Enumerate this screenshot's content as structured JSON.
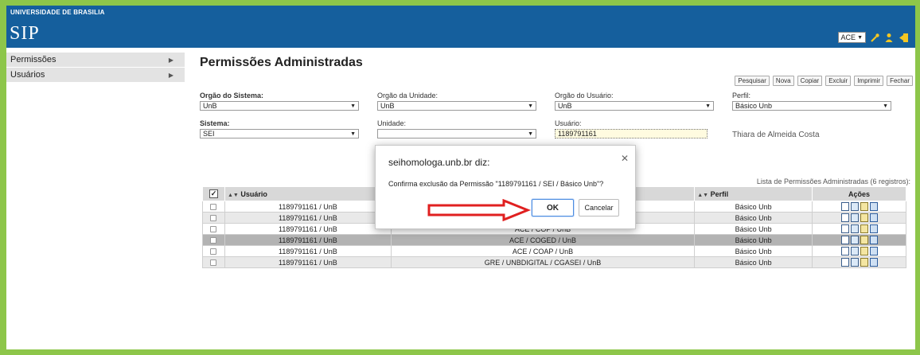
{
  "header": {
    "university": "UNIVERSIDADE DE BRASILIA",
    "app_logo": "SIP",
    "unit_selector": "ACE",
    "icons": [
      "wrench-icon",
      "user-icon",
      "exit-icon"
    ]
  },
  "sidebar": {
    "items": [
      {
        "label": "Permissões"
      },
      {
        "label": "Usuários"
      }
    ]
  },
  "page": {
    "title": "Permissões Administradas"
  },
  "toolbar": {
    "pesquisar": "Pesquisar",
    "nova": "Nova",
    "copiar": "Copiar",
    "excluir": "Excluir",
    "imprimir": "Imprimir",
    "fechar": "Fechar"
  },
  "filters": {
    "orgao_sistema": {
      "label": "Orgão do Sistema:",
      "value": "UnB"
    },
    "orgao_unidade": {
      "label": "Orgão da Unidade:",
      "value": "UnB"
    },
    "orgao_usuario": {
      "label": "Orgão do Usuário:",
      "value": "UnB"
    },
    "perfil": {
      "label": "Perfil:",
      "value": "Básico Unb"
    },
    "sistema": {
      "label": "Sistema:",
      "value": "SEI"
    },
    "unidade": {
      "label": "Unidade:",
      "value": ""
    },
    "usuario": {
      "label": "Usuário:",
      "value": "1189791161"
    },
    "user_name": "Thiara de Almeida Costa"
  },
  "table": {
    "caption": "Lista de Permissões Administradas (6 registros):",
    "headers": {
      "usuario": "Usuário",
      "unidade": "",
      "perfil": "Perfil",
      "acoes": "Ações"
    },
    "rows": [
      {
        "usuario": "1189791161 / UnB",
        "unidade": "",
        "perfil": "Básico Unb"
      },
      {
        "usuario": "1189791161 / UnB",
        "unidade": "",
        "perfil": "Básico Unb"
      },
      {
        "usuario": "1189791161 / UnB",
        "unidade": "ACE / COP / UnB",
        "perfil": "Básico Unb"
      },
      {
        "usuario": "1189791161 / UnB",
        "unidade": "ACE / COGED / UnB",
        "perfil": "Básico Unb"
      },
      {
        "usuario": "1189791161 / UnB",
        "unidade": "ACE / COAP / UnB",
        "perfil": "Básico Unb"
      },
      {
        "usuario": "1189791161 / UnB",
        "unidade": "GRE / UNBDIGITAL / CGASEI / UnB",
        "perfil": "Básico Unb"
      }
    ]
  },
  "dialog": {
    "title": "seihomologa.unb.br diz:",
    "message": "Confirma exclusão da Permissão \"1189791161 / SEI / Básico Unb\"?",
    "ok": "OK",
    "cancel": "Cancelar"
  },
  "colors": {
    "frame_background": "#8dc64a",
    "header_background": "#155f9d",
    "annotation_arrow": "#e02020"
  }
}
